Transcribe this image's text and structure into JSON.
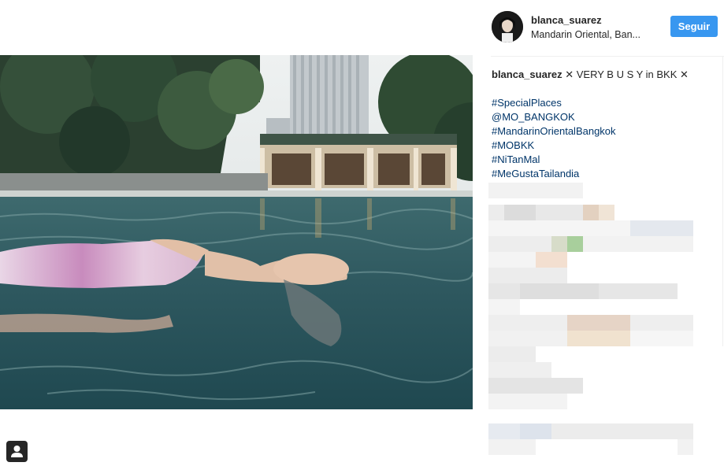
{
  "post": {
    "username": "blanca_suarez",
    "location": "Mandarin Oriental, Ban...",
    "follow_label": "Seguir"
  },
  "caption": {
    "username": "blanca_suarez",
    "text": "✕ VERY B U S Y in BKK ✕",
    "tags": [
      "#SpecialPlaces",
      "@MO_BANGKOK",
      "#MandarinOrientalBangkok",
      "#MOBKK",
      "#NiTanMal",
      "#MeGustaTailandia"
    ]
  },
  "colors": {
    "follow_button": "#3897f0",
    "link": "#003569",
    "text": "#262626"
  },
  "icons": {
    "profile": "person-icon"
  }
}
